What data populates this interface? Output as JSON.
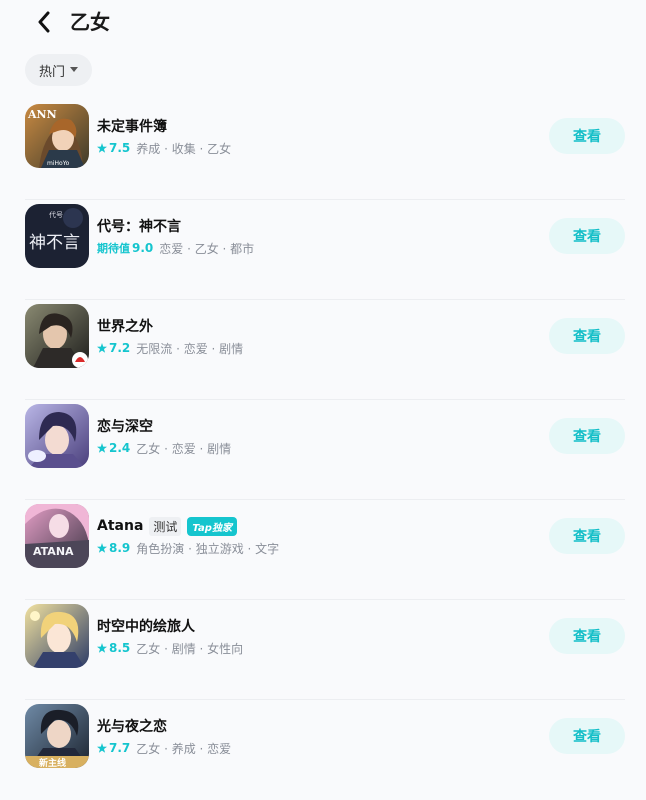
{
  "header": {
    "title": "乙女"
  },
  "sort": {
    "label": "热门"
  },
  "colors": {
    "accent": "#15c5ce",
    "button_bg": "#e6f8f8"
  },
  "games": [
    {
      "name": "未定事件簿",
      "score": "7.5",
      "tags": "养成 · 收集 · 乙女",
      "button": "查看"
    },
    {
      "name": "代号：神不言",
      "score_label": "期待值",
      "score": "9.0",
      "tags": "恋爱 · 乙女 · 都市",
      "button": "查看"
    },
    {
      "name": "世界之外",
      "score": "7.2",
      "tags": "无限流 · 恋爱 · 剧情",
      "button": "查看"
    },
    {
      "name": "恋与深空",
      "score": "2.4",
      "tags": "乙女 · 恋爱 · 剧情",
      "button": "查看"
    },
    {
      "name": "Atana",
      "badge_test": "测试",
      "badge_tap": "Tap独家",
      "score": "8.9",
      "tags": "角色扮演 · 独立游戏 · 文字",
      "button": "查看"
    },
    {
      "name": "时空中的绘旅人",
      "score": "8.5",
      "tags": "乙女 · 剧情 · 女性向",
      "button": "查看"
    },
    {
      "name": "光与夜之恋",
      "score": "7.7",
      "tags": "乙女 · 养成 · 恋爱",
      "button": "查看"
    }
  ],
  "icon_texts": {
    "ann": "ANN",
    "mihoyo": "miHoYo",
    "daihao": "代号",
    "shenbuyan": "神不言",
    "atana": "ATANA",
    "xinzhuxian": "新主线"
  }
}
